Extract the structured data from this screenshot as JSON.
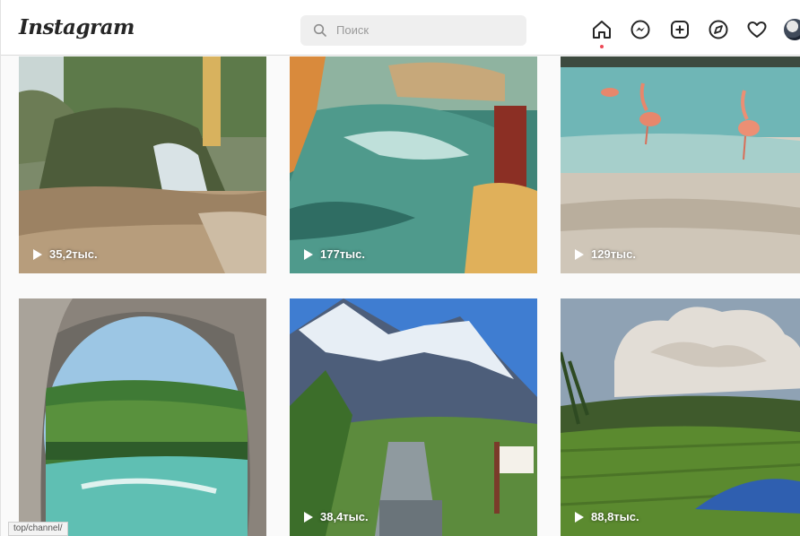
{
  "header": {
    "logo": "Instagram",
    "search": {
      "placeholder": "Поиск",
      "icon": "search-icon"
    },
    "nav_icons": [
      "home-icon",
      "messenger-icon",
      "new-post-icon",
      "explore-icon",
      "activity-heart-icon",
      "avatar"
    ],
    "active": "home-icon",
    "notification_color": "#ed4956"
  },
  "grid": {
    "tiles": [
      {
        "scene": "waterfall",
        "views": "35,2тыс."
      },
      {
        "scene": "water-park",
        "views": "177тыс."
      },
      {
        "scene": "flamingo-beach",
        "views": "129тыс."
      },
      {
        "scene": "tunnel-river",
        "views": ""
      },
      {
        "scene": "mountain-stairs",
        "views": "38,4тыс."
      },
      {
        "scene": "volcano-rice-field",
        "views": "88,8тыс."
      }
    ]
  },
  "status_bar": {
    "url": "top/channel/"
  }
}
